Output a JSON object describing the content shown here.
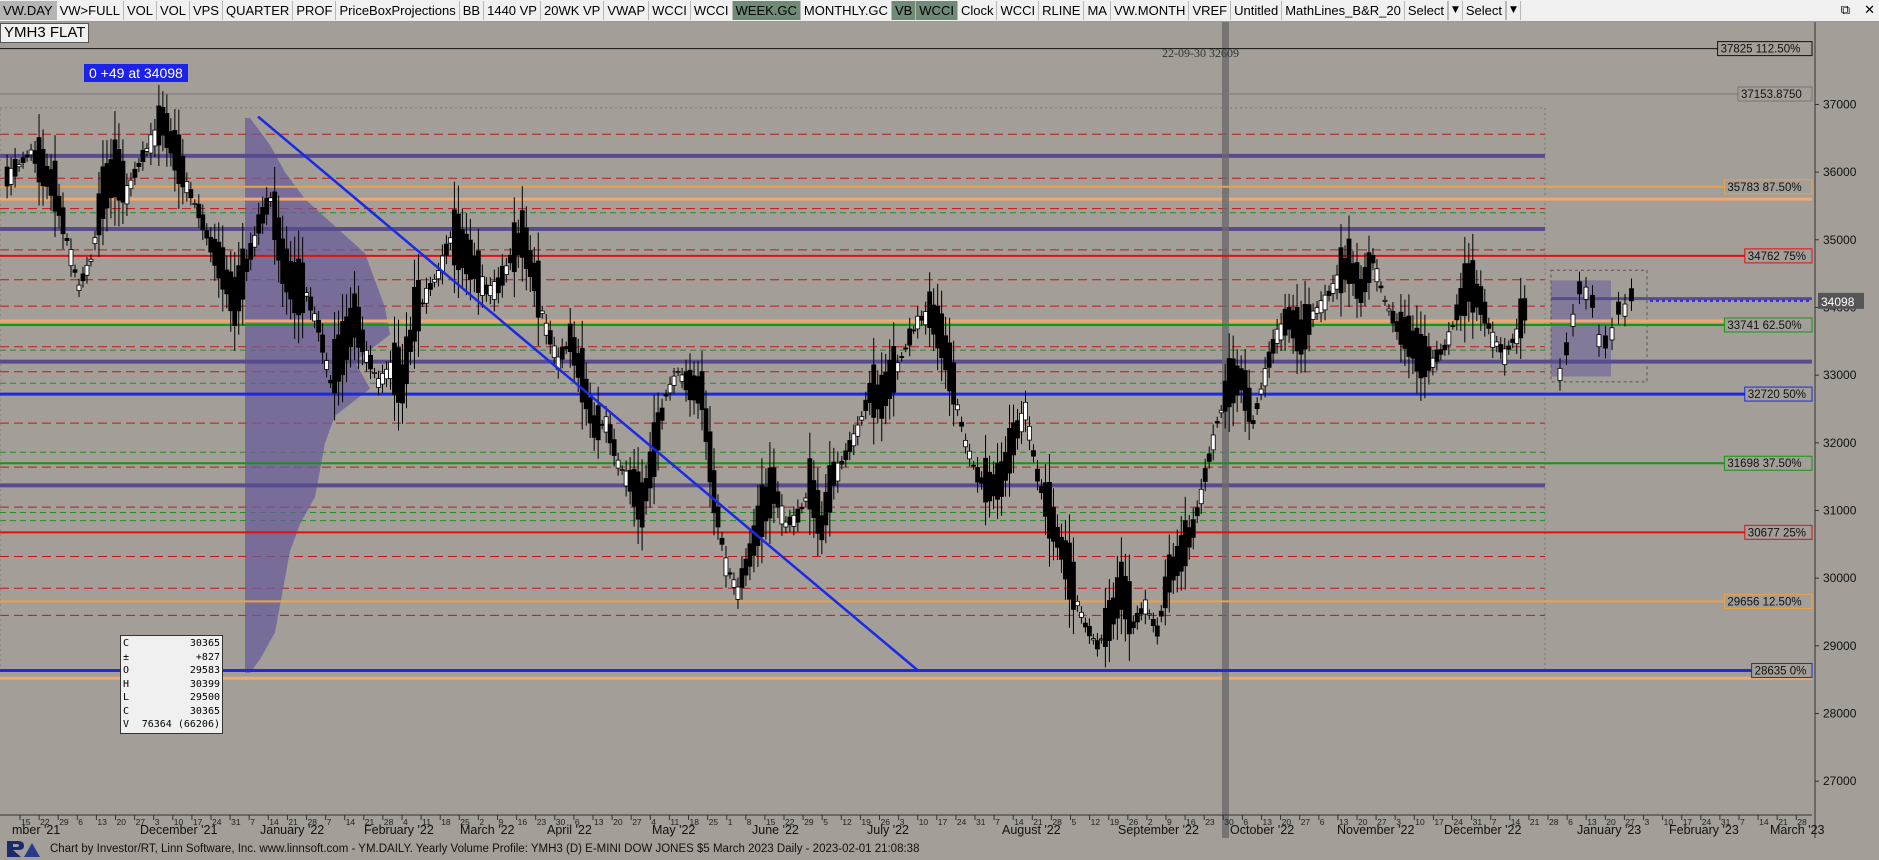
{
  "toolbar": {
    "buttons": [
      "VW.DAY",
      "VW>FULL",
      "VOL",
      "VOL",
      "VPS",
      "QUARTER",
      "PROF",
      "PriceBoxProjections",
      "BB",
      "1440 VP",
      "20WK VP",
      "VWAP",
      "WCCI",
      "WCCI",
      "WEEK.GC",
      "MONTHLY.GC",
      "VB",
      "WCCI",
      "Clock",
      "WCCI",
      "RLINE",
      "MA",
      "VW.MONTH",
      "VREF",
      "Untitled",
      "MathLines_B&R_20"
    ],
    "select1": "Select",
    "select2": "Select",
    "arrow_icon": "chevron-down-icon"
  },
  "window_controls": {
    "restore_icon": "restore-icon",
    "close_icon": "close-icon"
  },
  "symbol_label": "YMH3 FLAT",
  "change_label": "0   +49 at 34098",
  "cursor_date_label": "22-09-30  32609",
  "footer_text": "Chart by Investor/RT, Linn Software, Inc. www.linnsoft.com - YM.DAILY. Yearly Volume Profile: YMH3 (D) E-MINI DOW JONES $5 March 2023 Daily - 2023-02-01 21:08:38",
  "ohlc": [
    {
      "k": "C",
      "v": "30365"
    },
    {
      "k": "±",
      "v": "+827"
    },
    {
      "k": "O",
      "v": "29583"
    },
    {
      "k": "H",
      "v": "30399"
    },
    {
      "k": "L",
      "v": "29500"
    },
    {
      "k": "C",
      "v": "30365"
    },
    {
      "k": "V",
      "v": "76364  (66206)"
    }
  ],
  "chart_data": {
    "type": "candlestick",
    "y_axis": {
      "min": 26500,
      "max": 38100,
      "ticks": [
        27000,
        28000,
        29000,
        30000,
        31000,
        32000,
        33000,
        34000,
        35000,
        36000,
        37000
      ]
    },
    "last_price": 34098,
    "price_levels": [
      {
        "label": "37825 112.50%",
        "value": 37825,
        "color": "#111111"
      },
      {
        "label": "37153.8750",
        "value": 37154,
        "color": "#777777"
      },
      {
        "label": "35783 87.50%",
        "value": 35783,
        "color": "#e8a34a"
      },
      {
        "label": "34762 75%",
        "value": 34762,
        "color": "#e01010"
      },
      {
        "label": "33741 62.50%",
        "value": 33741,
        "color": "#119911"
      },
      {
        "label": "32720 50%",
        "value": 32720,
        "color": "#1a2ae6"
      },
      {
        "label": "31698 37.50%",
        "value": 31698,
        "color": "#119911"
      },
      {
        "label": "30677 25%",
        "value": 30677,
        "color": "#e01010"
      },
      {
        "label": "29656 12.50%",
        "value": 29656,
        "color": "#e8a34a"
      },
      {
        "label": "28635 0%",
        "value": 28635,
        "color": "#1a2ae6"
      }
    ],
    "x_month_labels": [
      "mber '21",
      "December '21",
      "January '22",
      "February '22",
      "March '22",
      "April '22",
      "May '22",
      "June '22",
      "July '22",
      "August '22",
      "September '22",
      "October '22",
      "November '22",
      "December '22",
      "January '23",
      "February '23",
      "March '23"
    ],
    "x_day_ticks": [
      "15",
      "22",
      "29",
      "6",
      "13",
      "20",
      "27",
      "3",
      "10",
      "17",
      "24",
      "31",
      "7",
      "14",
      "21",
      "28",
      "7",
      "14",
      "21",
      "28",
      "4",
      "11",
      "18",
      "25",
      "2",
      "9",
      "16",
      "23",
      "30",
      "6",
      "13",
      "20",
      "27",
      "4",
      "11",
      "18",
      "25",
      "1",
      "8",
      "15",
      "22",
      "29",
      "5",
      "12",
      "19",
      "26",
      "3",
      "10",
      "17",
      "24",
      "31",
      "7",
      "14",
      "21",
      "28",
      "5",
      "12",
      "19",
      "26",
      "2",
      "9",
      "16",
      "23",
      "30",
      "6",
      "13",
      "20",
      "27",
      "6",
      "13",
      "20",
      "27",
      "3",
      "10",
      "17",
      "24",
      "31",
      "7",
      "14",
      "21",
      "28",
      "6",
      "13",
      "20",
      "27",
      "3",
      "10",
      "17",
      "24",
      "31",
      "7",
      "14",
      "21",
      "28",
      "6",
      "13",
      "20"
    ],
    "price_path": [
      [
        0,
        35900
      ],
      [
        3,
        36100
      ],
      [
        6,
        36300
      ],
      [
        9,
        36000
      ],
      [
        12,
        35700
      ],
      [
        15,
        35000
      ],
      [
        18,
        34300
      ],
      [
        21,
        34700
      ],
      [
        24,
        35600
      ],
      [
        27,
        35950
      ],
      [
        30,
        35700
      ],
      [
        33,
        36100
      ],
      [
        36,
        36450
      ],
      [
        39,
        36700
      ],
      [
        42,
        36250
      ],
      [
        45,
        35800
      ],
      [
        48,
        35400
      ],
      [
        51,
        34900
      ],
      [
        54,
        34500
      ],
      [
        57,
        34000
      ],
      [
        60,
        34600
      ],
      [
        63,
        35200
      ],
      [
        66,
        35600
      ],
      [
        69,
        34600
      ],
      [
        72,
        34200
      ],
      [
        75,
        34200
      ],
      [
        78,
        33700
      ],
      [
        81,
        32900
      ],
      [
        84,
        33300
      ],
      [
        87,
        33800
      ],
      [
        90,
        33300
      ],
      [
        93,
        32900
      ],
      [
        96,
        33100
      ],
      [
        99,
        32800
      ],
      [
        102,
        33800
      ],
      [
        105,
        34200
      ],
      [
        108,
        34500
      ],
      [
        111,
        35000
      ],
      [
        114,
        34800
      ],
      [
        117,
        34550
      ],
      [
        120,
        34250
      ],
      [
        123,
        34300
      ],
      [
        126,
        34700
      ],
      [
        129,
        35000
      ],
      [
        132,
        34400
      ],
      [
        135,
        33700
      ],
      [
        138,
        33200
      ],
      [
        141,
        33500
      ],
      [
        144,
        32900
      ],
      [
        147,
        32200
      ],
      [
        150,
        32300
      ],
      [
        153,
        31700
      ],
      [
        156,
        31400
      ],
      [
        159,
        31000
      ],
      [
        162,
        31800
      ],
      [
        165,
        32700
      ],
      [
        168,
        33050
      ],
      [
        171,
        32800
      ],
      [
        174,
        32700
      ],
      [
        177,
        31200
      ],
      [
        180,
        30200
      ],
      [
        183,
        29800
      ],
      [
        186,
        30300
      ],
      [
        189,
        30900
      ],
      [
        192,
        31300
      ],
      [
        195,
        30800
      ],
      [
        198,
        30900
      ],
      [
        201,
        31300
      ],
      [
        204,
        30700
      ],
      [
        207,
        31500
      ],
      [
        210,
        31800
      ],
      [
        213,
        32200
      ],
      [
        216,
        32700
      ],
      [
        219,
        32600
      ],
      [
        222,
        33000
      ],
      [
        225,
        33400
      ],
      [
        228,
        33800
      ],
      [
        231,
        33900
      ],
      [
        234,
        33500
      ],
      [
        237,
        32800
      ],
      [
        240,
        32000
      ],
      [
        243,
        31500
      ],
      [
        246,
        31300
      ],
      [
        249,
        31400
      ],
      [
        252,
        32000
      ],
      [
        255,
        32500
      ],
      [
        258,
        31500
      ],
      [
        261,
        30900
      ],
      [
        264,
        30400
      ],
      [
        267,
        29800
      ],
      [
        270,
        29300
      ],
      [
        273,
        29000
      ],
      [
        276,
        29300
      ],
      [
        279,
        29800
      ],
      [
        282,
        29300
      ],
      [
        285,
        29600
      ],
      [
        288,
        29200
      ],
      [
        291,
        30000
      ],
      [
        294,
        30300
      ],
      [
        297,
        30700
      ],
      [
        300,
        31500
      ],
      [
        303,
        32300
      ],
      [
        306,
        32800
      ],
      [
        309,
        32900
      ],
      [
        312,
        32300
      ],
      [
        315,
        33000
      ],
      [
        318,
        33600
      ],
      [
        321,
        33800
      ],
      [
        324,
        33500
      ],
      [
        327,
        33900
      ],
      [
        330,
        34100
      ],
      [
        333,
        34400
      ],
      [
        336,
        34600
      ],
      [
        339,
        34200
      ],
      [
        342,
        34700
      ],
      [
        345,
        34100
      ],
      [
        348,
        33700
      ],
      [
        351,
        33500
      ],
      [
        354,
        33200
      ],
      [
        357,
        33200
      ],
      [
        360,
        33400
      ],
      [
        363,
        33900
      ],
      [
        366,
        34300
      ],
      [
        369,
        34050
      ],
      [
        372,
        33550
      ],
      [
        375,
        33300
      ],
      [
        378,
        33600
      ],
      [
        381,
        34098
      ]
    ]
  }
}
